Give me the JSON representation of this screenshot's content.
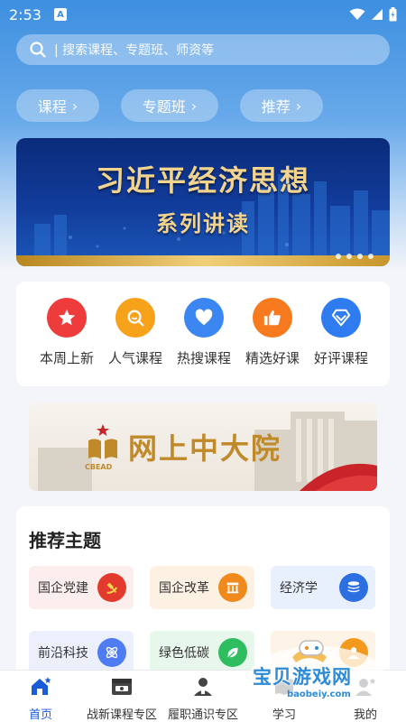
{
  "status_bar": {
    "time": "2:53",
    "notif_glyph": "A"
  },
  "search": {
    "placeholder": "| 搜索课程、专题班、师资等"
  },
  "pills": [
    {
      "label": "课程"
    },
    {
      "label": "专题班"
    },
    {
      "label": "推荐"
    }
  ],
  "banner": {
    "title": "习近平经济思想",
    "subtitle": "系列讲读",
    "page_count": 4
  },
  "quick_entries": [
    {
      "label": "本周上新",
      "icon": "star-icon",
      "color": "#ee3b3b"
    },
    {
      "label": "人气课程",
      "icon": "search-popular-icon",
      "color": "#f7a21b"
    },
    {
      "label": "热搜课程",
      "icon": "heart-icon",
      "color": "#3b86f0"
    },
    {
      "label": "精选好课",
      "icon": "thumbs-up-icon",
      "color": "#f87a1e"
    },
    {
      "label": "好评课程",
      "icon": "diamond-icon",
      "color": "#2f7cf0"
    }
  ],
  "campus_banner": {
    "title": "网上中大院",
    "logo_text": "CBEAD"
  },
  "topics": {
    "title": "推荐主题",
    "items": [
      {
        "label": "国企党建",
        "icon": "party-emblem-icon",
        "color": "#e23a2c",
        "bg": "#fdeeee"
      },
      {
        "label": "国企改革",
        "icon": "building-icon",
        "color": "#f08a1c",
        "bg": "#fdf1e4"
      },
      {
        "label": "经济学",
        "icon": "coin-stack-icon",
        "color": "#2c6fe0",
        "bg": "#e9f0fd"
      },
      {
        "label": "前沿科技",
        "icon": "atom-icon",
        "color": "#4f7cf3",
        "bg": "#ecf0fd"
      },
      {
        "label": "绿色低碳",
        "icon": "leaf-icon",
        "color": "#2ebd5f",
        "bg": "#e8f7ec"
      },
      {
        "label": "",
        "icon": "person-icon",
        "color": "#f39a1e",
        "bg": "#fdf3e6"
      }
    ]
  },
  "tabbar": {
    "items": [
      {
        "label": "首页",
        "icon": "home-icon",
        "active": true
      },
      {
        "label": "战新课程专区",
        "icon": "calendar-card-icon",
        "active": false
      },
      {
        "label": "履职通识专区",
        "icon": "user-badge-icon",
        "active": false
      },
      {
        "label": "学习",
        "icon": "book-icon",
        "active": false
      },
      {
        "label": "我的",
        "icon": "profile-icon",
        "active": false
      }
    ]
  },
  "watermark": {
    "text": "宝贝游戏网",
    "url": "baobeiy.com"
  }
}
